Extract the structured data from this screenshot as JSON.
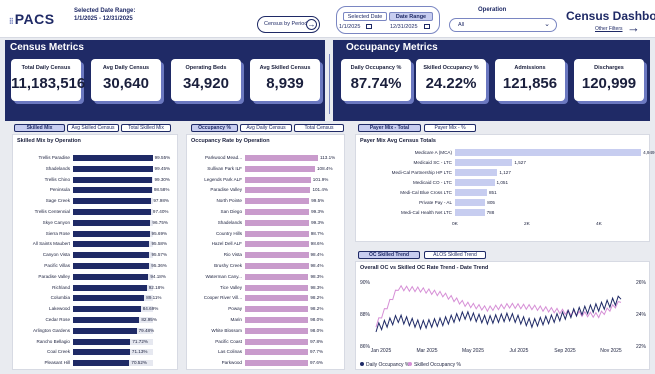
{
  "header": {
    "logo": "PACS",
    "date_range_label": "Selected Date Range:",
    "date_range_value": "1/1/2025 - 12/31/2025",
    "census_by_period": "Census by Period",
    "date_tabs": [
      "Selected Date",
      "Date Range"
    ],
    "date_from": "1/1/2025",
    "date_to": "12/31/2025",
    "operation_label": "Operation",
    "operation_value": "All",
    "title": "Census Dashboard",
    "other_filters": "Other Filters",
    "accent": "#1f2a66"
  },
  "census_metrics": {
    "heading": "Census Metrics",
    "cards": [
      {
        "label": "Total Daily Census",
        "value": "11,183,516"
      },
      {
        "label": "Avg Daily Census",
        "value": "30,640"
      },
      {
        "label": "Operating Beds",
        "value": "34,920"
      },
      {
        "label": "Avg Skilled Census",
        "value": "8,939"
      }
    ]
  },
  "occupancy_metrics": {
    "heading": "Occupancy Metrics",
    "cards": [
      {
        "label": "Daily Occupancy %",
        "value": "87.74%"
      },
      {
        "label": "Skilled Occupancy %",
        "value": "24.22%"
      },
      {
        "label": "Admissions",
        "value": "121,856"
      },
      {
        "label": "Discharges",
        "value": "120,999"
      }
    ]
  },
  "skilled_panel": {
    "tabs": [
      "Skilled Mix",
      "Avg Skilled Census",
      "Total Skilled Mix"
    ],
    "title": "Skilled Mix by Operation",
    "rows": [
      {
        "name": "Trellis Paradise",
        "pct": "99.55%",
        "v": 99.55
      },
      {
        "name": "Shadelands",
        "pct": "99.45%",
        "v": 99.45
      },
      {
        "name": "Trellis Chino",
        "pct": "99.30%",
        "v": 99.3
      },
      {
        "name": "Peninsula",
        "pct": "98.58%",
        "v": 98.58
      },
      {
        "name": "Sage Creek",
        "pct": "97.98%",
        "v": 97.98
      },
      {
        "name": "Trellis Centennial",
        "pct": "97.40%",
        "v": 97.4
      },
      {
        "name": "Skye Canyon",
        "pct": "96.75%",
        "v": 96.75
      },
      {
        "name": "Sierra Rose",
        "pct": "95.69%",
        "v": 95.69
      },
      {
        "name": "All Saints Maubert",
        "pct": "95.58%",
        "v": 95.58
      },
      {
        "name": "Canyon Vista",
        "pct": "95.57%",
        "v": 95.57
      },
      {
        "name": "Pacific Villas",
        "pct": "95.36%",
        "v": 95.36
      },
      {
        "name": "Paradise Valley",
        "pct": "94.18%",
        "v": 94.18
      },
      {
        "name": "Richland",
        "pct": "92.18%",
        "v": 92.18
      },
      {
        "name": "Columbia",
        "pct": "89.11%",
        "v": 89.11
      },
      {
        "name": "Lakewood",
        "pct": "84.69%",
        "v": 84.69
      },
      {
        "name": "Cedar Rose",
        "pct": "82.95%",
        "v": 82.95
      },
      {
        "name": "Arlington Gardens",
        "pct": "79.48%",
        "v": 79.48
      },
      {
        "name": "Rancho Bellagio",
        "pct": "71.72%",
        "v": 71.72
      },
      {
        "name": "Coal Creek",
        "pct": "71.13%",
        "v": 71.13
      },
      {
        "name": "Pleasant Hill",
        "pct": "70.52%",
        "v": 70.52
      }
    ]
  },
  "occupancy_panel": {
    "tabs": [
      "Occupancy %",
      "Avg Daily Census",
      "Total Census"
    ],
    "title": "Occupancy Rate by Operation",
    "rows": [
      {
        "name": "Parkwood Mead...",
        "pct": "113.1%",
        "v": 113.1
      },
      {
        "name": "Sullivan Park ILF",
        "pct": "108.4%",
        "v": 108.4
      },
      {
        "name": "Legends Park ALF",
        "pct": "101.9%",
        "v": 101.9
      },
      {
        "name": "Paradise Valley",
        "pct": "101.4%",
        "v": 101.4
      },
      {
        "name": "North Pointe",
        "pct": "99.5%",
        "v": 99.5
      },
      {
        "name": "San Diego",
        "pct": "99.3%",
        "v": 99.3
      },
      {
        "name": "Shadelands",
        "pct": "99.3%",
        "v": 99.3
      },
      {
        "name": "Country Hills",
        "pct": "98.7%",
        "v": 98.7
      },
      {
        "name": "Hazel Dell ALF",
        "pct": "98.6%",
        "v": 98.6
      },
      {
        "name": "Rio Vista",
        "pct": "98.4%",
        "v": 98.4
      },
      {
        "name": "Brushy Creek",
        "pct": "98.4%",
        "v": 98.4
      },
      {
        "name": "Waterman Cany...",
        "pct": "98.3%",
        "v": 98.3
      },
      {
        "name": "Tice Valley",
        "pct": "98.3%",
        "v": 98.3
      },
      {
        "name": "Cooper River Vill...",
        "pct": "98.2%",
        "v": 98.2
      },
      {
        "name": "Poway",
        "pct": "98.2%",
        "v": 98.2
      },
      {
        "name": "Marin",
        "pct": "98.0%",
        "v": 98.0
      },
      {
        "name": "White Blossom",
        "pct": "98.0%",
        "v": 98.0
      },
      {
        "name": "Pacific Coast",
        "pct": "97.8%",
        "v": 97.8
      },
      {
        "name": "Las Colinas",
        "pct": "97.7%",
        "v": 97.7
      },
      {
        "name": "Parkwood",
        "pct": "97.6%",
        "v": 97.6
      }
    ]
  },
  "payer_panel": {
    "tabs": [
      "Payer Mix - Total",
      "Payer Mix - %"
    ],
    "title": "Payer Mix Avg Census Totals",
    "rows": [
      {
        "name": "Medicare A (MCA)",
        "value": "4,949",
        "v": 4949
      },
      {
        "name": "Medicaid SC - LTC",
        "value": "1,527",
        "v": 1527
      },
      {
        "name": "Medi-Cal Partnership HP LTC",
        "value": "1,127",
        "v": 1127
      },
      {
        "name": "Medicaid CO - LTC",
        "value": "1,051",
        "v": 1051
      },
      {
        "name": "Medi-Cal Blue Cross LTC",
        "value": "851",
        "v": 851
      },
      {
        "name": "Private Pay - AL",
        "value": "805",
        "v": 805
      },
      {
        "name": "Medi-Cal Health Net LTC",
        "value": "788",
        "v": 788
      }
    ],
    "axis_ticks": [
      "0K",
      "2K",
      "4K"
    ]
  },
  "trend_panel": {
    "tabs": [
      "OC Skilled Trend",
      "ALOS Skilled Trend"
    ],
    "title": "Overall OC vs Skilled OC Rate Trend - Date Trend",
    "left_ticks": [
      "90%",
      "88%",
      "86%"
    ],
    "right_ticks": [
      "26%",
      "24%",
      "22%"
    ],
    "x_ticks": [
      "Jan 2025",
      "Mar 2025",
      "May 2025",
      "Jul 2025",
      "Sep 2025",
      "Nov 2025"
    ],
    "legend": [
      "Daily Occupancy %",
      "Skilled Occupancy %"
    ],
    "colors": {
      "daily": "#1f2a66",
      "skilled": "#d68fd6"
    }
  },
  "chart_data": [
    {
      "type": "bar",
      "title": "Skilled Mix by Operation",
      "categories": [
        "Trellis Paradise",
        "Shadelands",
        "Trellis Chino",
        "Peninsula",
        "Sage Creek",
        "Trellis Centennial",
        "Skye Canyon",
        "Sierra Rose",
        "All Saints Maubert",
        "Canyon Vista",
        "Pacific Villas",
        "Paradise Valley",
        "Richland",
        "Columbia",
        "Lakewood",
        "Cedar Rose",
        "Arlington Gardens",
        "Rancho Bellagio",
        "Coal Creek",
        "Pleasant Hill"
      ],
      "values": [
        99.55,
        99.45,
        99.3,
        98.58,
        97.98,
        97.4,
        96.75,
        95.69,
        95.58,
        95.57,
        95.36,
        94.18,
        92.18,
        89.11,
        84.69,
        82.95,
        79.48,
        71.72,
        71.13,
        70.52
      ]
    },
    {
      "type": "bar",
      "title": "Occupancy Rate by Operation",
      "categories": [
        "Parkwood Mead...",
        "Sullivan Park ILF",
        "Legends Park ALF",
        "Paradise Valley",
        "North Pointe",
        "San Diego",
        "Shadelands",
        "Country Hills",
        "Hazel Dell ALF",
        "Rio Vista",
        "Brushy Creek",
        "Waterman Cany...",
        "Tice Valley",
        "Cooper River Vill...",
        "Poway",
        "Marin",
        "White Blossom",
        "Pacific Coast",
        "Las Colinas",
        "Parkwood"
      ],
      "values": [
        113.1,
        108.4,
        101.9,
        101.4,
        99.5,
        99.3,
        99.3,
        98.7,
        98.6,
        98.4,
        98.4,
        98.3,
        98.3,
        98.2,
        98.2,
        98.0,
        98.0,
        97.8,
        97.7,
        97.6
      ]
    },
    {
      "type": "bar",
      "title": "Payer Mix Avg Census Totals",
      "categories": [
        "Medicare A (MCA)",
        "Medicaid SC - LTC",
        "Medi-Cal Partnership HP LTC",
        "Medicaid CO - LTC",
        "Medi-Cal Blue Cross LTC",
        "Private Pay - AL",
        "Medi-Cal Health Net LTC"
      ],
      "values": [
        4949,
        1527,
        1127,
        1051,
        851,
        805,
        788
      ]
    },
    {
      "type": "line",
      "title": "Overall OC vs Skilled OC Rate Trend - Date Trend",
      "x": [
        "Jan 2025",
        "Feb 2025",
        "Mar 2025",
        "Apr 2025",
        "May 2025",
        "Jun 2025",
        "Jul 2025",
        "Aug 2025",
        "Sep 2025",
        "Oct 2025",
        "Nov 2025",
        "Dec 2025"
      ],
      "series": [
        {
          "name": "Daily Occupancy %",
          "axis": "left",
          "values": [
            87.0,
            87.6,
            87.2,
            87.4,
            87.8,
            87.5,
            87.7,
            87.3,
            87.6,
            88.0,
            88.3,
            88.8
          ]
        },
        {
          "name": "Skilled Occupancy %",
          "axis": "right",
          "values": [
            23.2,
            25.5,
            25.4,
            25.1,
            24.5,
            24.2,
            24.4,
            24.3,
            24.1,
            23.9,
            23.8,
            24.6
          ]
        }
      ],
      "ylim_left": [
        86,
        90
      ],
      "ylim_right": [
        22,
        26
      ]
    }
  ]
}
